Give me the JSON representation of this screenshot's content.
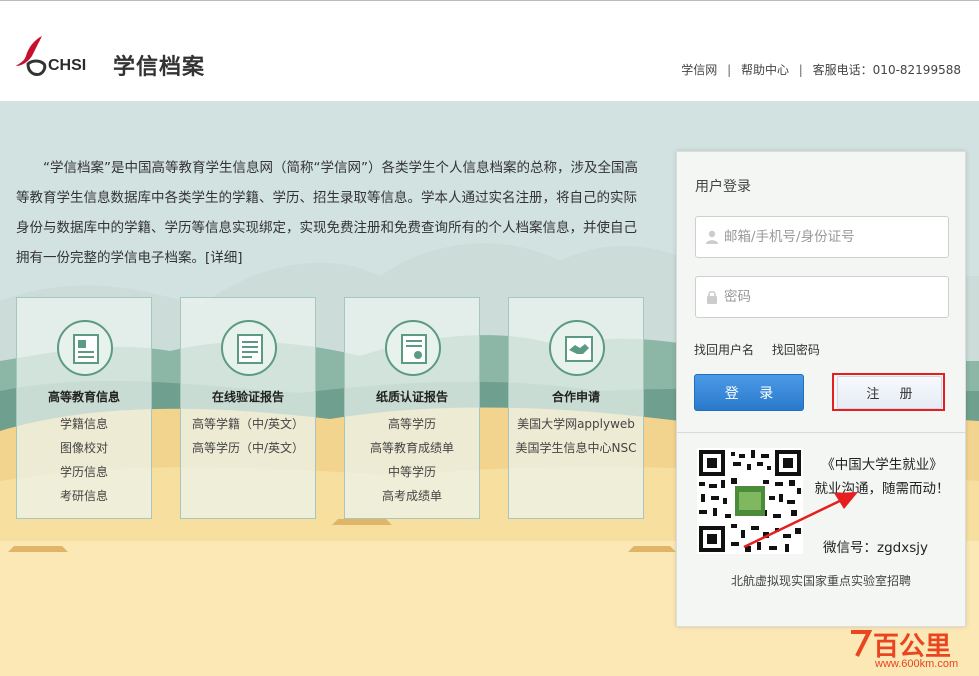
{
  "header": {
    "logo_text": "CHSI",
    "site_name": "学信档案",
    "links": [
      "学信网",
      "帮助中心"
    ],
    "hotline": "客服电话：010-82199588"
  },
  "intro": {
    "text": "“学信档案”是中国高等教育学生信息网（简称“学信网”）各类学生个人信息档案的总称，涉及全国高等教育学生信息数据库中各类学生的学籍、学历、招生录取等信息。学本人通过实名注册，将自己的实际身份与数据库中的学籍、学历等信息实现绑定，实现免费注册和免费查询所有的个人档案信息，并使自己拥有一份完整的学信电子档案。",
    "more_link": "[详细]"
  },
  "cards": [
    {
      "title": "高等教育信息",
      "items": [
        "学籍信息",
        "图像校对",
        "学历信息",
        "考研信息"
      ]
    },
    {
      "title": "在线验证报告",
      "items": [
        "高等学籍（中/英文）",
        "高等学历（中/英文）"
      ]
    },
    {
      "title": "纸质认证报告",
      "items": [
        "高等学历",
        "高等教育成绩单",
        "中等学历",
        "高考成绩单"
      ]
    },
    {
      "title": "合作申请",
      "items": [
        "美国大学网applyweb",
        "美国学生信息中心NSC"
      ]
    }
  ],
  "login": {
    "title": "用户登录",
    "username_placeholder": "邮箱/手机号/身份证号",
    "password_placeholder": "密码",
    "find_username": "找回用户名",
    "find_password": "找回密码",
    "login_label": "登 录",
    "register_label": "注 册",
    "qr_title": "《中国大学生就业》",
    "qr_slogan": "就业沟通，随需而动！",
    "wechat": "微信号：zgdxsjy",
    "ad": "北航虚拟现实国家重点实验室招聘"
  },
  "watermark": {
    "text": "百公里",
    "url": "www.600km.com"
  },
  "colors": {
    "login_blue": "#2b79cc",
    "highlight_red": "#e51f1f",
    "card_green": "#5c9a84"
  }
}
